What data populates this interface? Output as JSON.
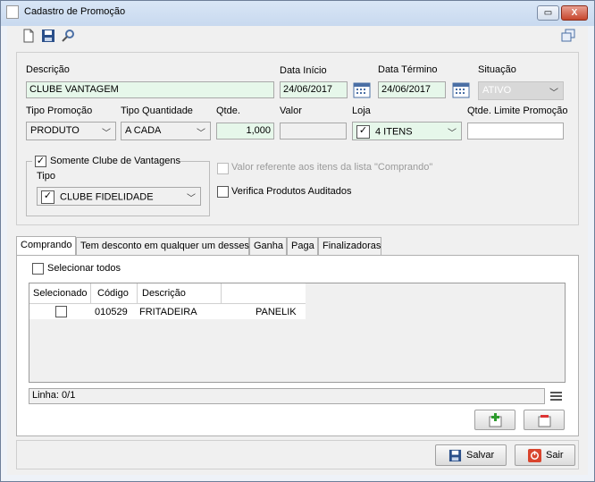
{
  "window": {
    "title": "Cadastro de Promoção",
    "minimize": "▭",
    "maximize": "☐",
    "close": "X"
  },
  "form": {
    "descricao": {
      "label": "Descrição",
      "value": "CLUBE VANTAGEM"
    },
    "data_inicio": {
      "label": "Data Início",
      "value": "24/06/2017"
    },
    "data_termino": {
      "label": "Data Término",
      "value": "24/06/2017"
    },
    "situacao": {
      "label": "Situação",
      "value": "ATIVO"
    },
    "tipo_promocao": {
      "label": "Tipo Promoção",
      "value": "PRODUTO"
    },
    "tipo_quantidade": {
      "label": "Tipo Quantidade",
      "value": "A CADA"
    },
    "qtde": {
      "label": "Qtde.",
      "value": "1,000"
    },
    "valor": {
      "label": "Valor",
      "value": ""
    },
    "loja": {
      "label": "Loja",
      "value": "4 ITENS"
    },
    "qtde_limite": {
      "label": "Qtde. Limite Promoção",
      "value": ""
    },
    "clube": {
      "label": "Somente Clube de Vantagens",
      "checked": true,
      "tipo_label": "Tipo",
      "tipo_value": "CLUBE FIDELIDADE"
    },
    "valor_referente": {
      "label": "Valor referente aos itens da lista \"Comprando\"",
      "checked": false,
      "enabled": false
    },
    "verifica": {
      "label": "Verifica Produtos Auditados",
      "checked": false
    }
  },
  "tabs": [
    "Comprando",
    "Tem desconto em qualquer um desses",
    "Ganha",
    "Paga",
    "Finalizadoras"
  ],
  "grid": {
    "select_all_label": "Selecionar todos",
    "columns": [
      "Selecionado",
      "Código",
      "Descrição"
    ],
    "rows": [
      {
        "selected": false,
        "codigo": "010529",
        "descricao": "FRITADEIRA",
        "marca": "PANELIK"
      }
    ],
    "status": "Linha: 0/1"
  },
  "footer": {
    "save_label": "Salvar",
    "exit_label": "Sair"
  },
  "colors": {
    "accent": "#e6f7ea",
    "title_bg": "#c8d9ef"
  }
}
